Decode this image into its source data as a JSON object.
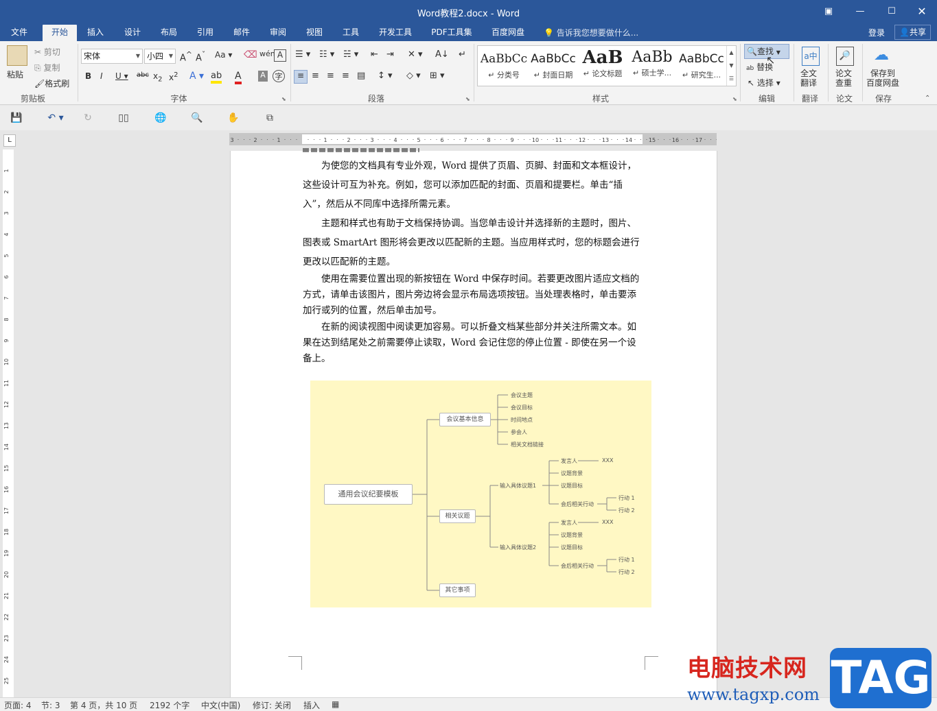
{
  "window": {
    "title": "Word教程2.docx - Word"
  },
  "menu": {
    "tabs": [
      "文件",
      "开始",
      "插入",
      "设计",
      "布局",
      "引用",
      "邮件",
      "审阅",
      "视图",
      "工具",
      "开发工具",
      "PDF工具集",
      "百度网盘"
    ],
    "tell_me": "告诉我您想要做什么...",
    "login": "登录",
    "share": "共享"
  },
  "ribbon": {
    "clipboard": {
      "paste": "粘贴",
      "cut": "剪切",
      "copy": "复制",
      "format_painter": "格式刷",
      "label": "剪贴板"
    },
    "font": {
      "name": "宋体",
      "size": "小四",
      "label": "字体",
      "aa": "Aa"
    },
    "paragraph": {
      "label": "段落"
    },
    "styles": {
      "label": "样式",
      "items": [
        {
          "preview": "AaBbCc",
          "name": "↵ 分类号"
        },
        {
          "preview": "AaBbCc",
          "name": "↵ 封面日期"
        },
        {
          "preview": "AaB",
          "name": "↵ 论文标题"
        },
        {
          "preview": "AaBb",
          "name": "↵ 硕士学..."
        },
        {
          "preview": "AaBbCc",
          "name": "↵ 研究生..."
        }
      ]
    },
    "editing": {
      "find": "查找",
      "replace": "替换",
      "select": "选择",
      "label": "编辑"
    },
    "translate": {
      "btn": "全文\n翻译",
      "label": "翻译"
    },
    "paper": {
      "btn": "论文\n查重",
      "label": "论文"
    },
    "save": {
      "btn": "保存到\n百度网盘",
      "label": "保存"
    }
  },
  "document": {
    "paragraphs": [
      "为使您的文档具有专业外观，Word 提供了页眉、页脚、封面和文本框设计，这些设计可互为补充。例如，您可以添加匹配的封面、页眉和提要栏。单击“插入”，然后从不同库中选择所需元素。",
      "主题和样式也有助于文档保持协调。当您单击设计并选择新的主题时，图片、图表或 SmartArt 图形将会更改以匹配新的主题。当应用样式时，您的标题会进行更改以匹配新的主题。",
      "使用在需要位置出现的新按钮在 Word 中保存时间。若要更改图片适应文档的方式，请单击该图片，图片旁边将会显示布局选项按钮。当处理表格时，单击要添加行或列的位置，然后单击加号。",
      "在新的阅读视图中阅读更加容易。可以折叠文档某些部分并关注所需文本。如果在达到结尾处之前需要停止读取，Word 会记住您的停止位置 - 即使在另一个设备上。"
    ],
    "mindmap": {
      "root": "通用会议纪要模板",
      "branch1": {
        "label": "会议基本信息",
        "children": [
          "会议主题",
          "会议目标",
          "时间地点",
          "参会人",
          "相关文档链接"
        ]
      },
      "branch2": {
        "label": "相关议题",
        "topics": [
          {
            "label": "输入具体议题1",
            "speaker": "发言人",
            "xxx": "XXX",
            "bg": "议题背景",
            "goal": "议题目标",
            "follow": "会后相关行动",
            "actions": [
              "行动 1",
              "行动 2"
            ]
          },
          {
            "label": "输入具体议题2",
            "speaker": "发言人",
            "xxx": "XXX",
            "bg": "议题背景",
            "goal": "议题目标",
            "follow": "会后相关行动",
            "actions": [
              "行动 1",
              "行动 2"
            ]
          }
        ]
      },
      "branch3": {
        "label": "其它事项"
      }
    }
  },
  "status": {
    "page": "页面: 4",
    "section": "节: 3",
    "pages": "第 4 页，共 10 页",
    "words": "2192 个字",
    "lang": "中文(中国)",
    "revise": "修订: 关闭",
    "insert": "插入"
  },
  "watermark": {
    "cn": "电脑技术网",
    "url": "www.tagxp.com",
    "tag": "TAG"
  }
}
